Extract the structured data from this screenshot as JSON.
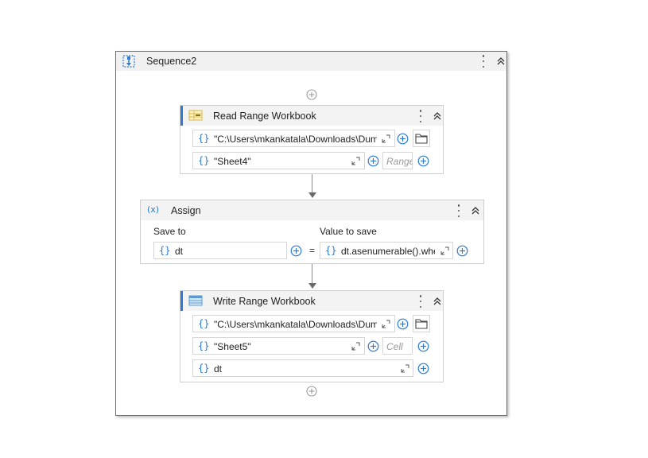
{
  "sequence": {
    "title": "Sequence2"
  },
  "read_range": {
    "title": "Read Range Workbook",
    "path_value": "\"C:\\Users\\mkankatala\\Downloads\\Dum",
    "sheet_value": "\"Sheet4\"",
    "range_placeholder": "Range"
  },
  "assign": {
    "title": "Assign",
    "save_to_label": "Save to",
    "value_label": "Value to save",
    "save_to_value": "dt",
    "value_value": "dt.asenumerable().whe",
    "equals": "="
  },
  "write_range": {
    "title": "Write Range Workbook",
    "path_value": "\"C:\\Users\\mkankatala\\Downloads\\Dum",
    "sheet_value": "\"Sheet5\"",
    "cell_placeholder": "Cell",
    "data_value": "dt"
  },
  "icons": {
    "braces": "{}",
    "sequence_icon": "sequence-icon",
    "assign_icon": "(x)"
  },
  "colors": {
    "accent": "#2d7bd1",
    "header_bg": "#f3f3f3"
  }
}
